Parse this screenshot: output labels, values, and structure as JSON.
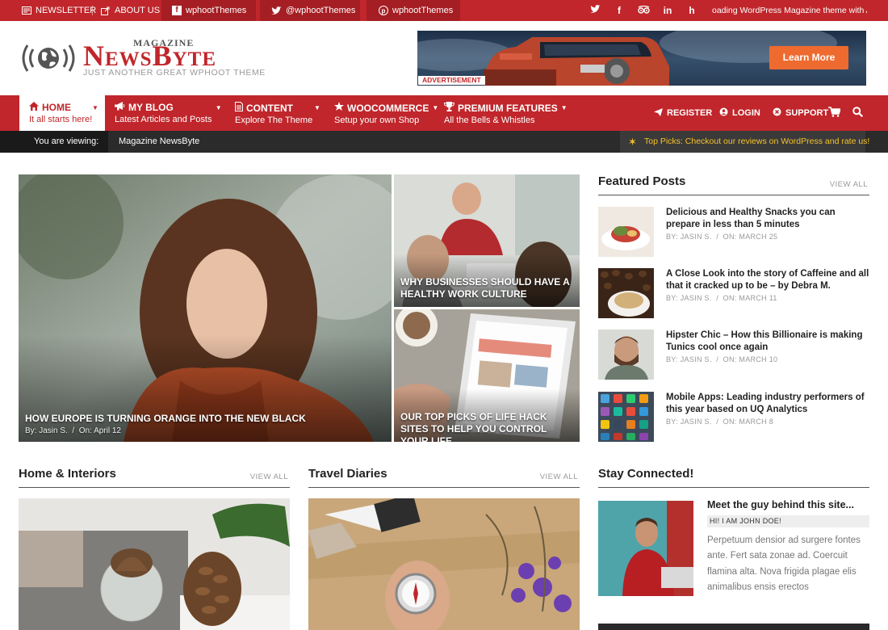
{
  "colors": {
    "brand": "#c0262b",
    "dark": "#2b2b2b",
    "highlight": "#f6c22a"
  },
  "topbar": {
    "newsletter": "NEWSLETTER",
    "about": "ABOUT US",
    "facebook": "wphootThemes",
    "twitter": "@wphootThemes",
    "pinterest": "wphootThemes",
    "social_icons": [
      "twitter-icon",
      "facebook-icon",
      "tripadvisor-icon",
      "linkedin-icon",
      "houzz-icon"
    ],
    "ticker": "oading WordPress Magazine theme with A+"
  },
  "header": {
    "logo_small": "MAGAZINE",
    "logo_main": "NewsByte",
    "tagline": "JUST ANOTHER GREAT WPHOOT THEME",
    "ad_button": "Learn More",
    "ad_label": "ADVERTISEMENT"
  },
  "nav": {
    "items": [
      {
        "title": "HOME",
        "sub": "It all starts here!",
        "icon": "home-icon"
      },
      {
        "title": "MY BLOG",
        "sub": "Latest Articles and Posts",
        "icon": "megaphone-icon"
      },
      {
        "title": "CONTENT",
        "sub": "Explore The Theme",
        "icon": "document-icon"
      },
      {
        "title": "WOOCOMMERCE",
        "sub": "Setup your own Shop",
        "icon": "woocommerce-icon"
      },
      {
        "title": "PREMIUM FEATURES",
        "sub": "All the Bells & Whistles",
        "icon": "trophy-icon"
      }
    ],
    "register": "REGISTER",
    "login": "LOGIN",
    "support": "SUPPORT"
  },
  "viewbar": {
    "label": "You are viewing:",
    "value": "Magazine NewsByte",
    "pick": "Top Picks: Checkout our reviews on WordPress and rate us!"
  },
  "hero": {
    "main": {
      "title": "HOW EUROPE IS TURNING ORANGE INTO THE NEW BLACK",
      "by_label": "By:",
      "author": "Jasin S.",
      "on_label": "On:",
      "date": "April 12"
    },
    "top_right": {
      "title": "WHY BUSINESSES SHOULD HAVE A HEALTHY WORK CULTURE"
    },
    "bottom_right": {
      "title": "OUR TOP PICKS OF LIFE HACK SITES TO HELP YOU CONTROL YOUR LIFE."
    }
  },
  "featured": {
    "heading": "Featured Posts",
    "view_all": "VIEW ALL",
    "by_label": "BY:",
    "on_label": "ON:",
    "posts": [
      {
        "title": "Delicious and Healthy Snacks you can prepare in less than 5 minutes",
        "author": "JASIN S.",
        "date": "MARCH 25"
      },
      {
        "title": "A Close Look into the story of Caffeine and all that it cracked up to be – by Debra M.",
        "author": "JASIN S.",
        "date": "MARCH 11"
      },
      {
        "title": "Hipster Chic – How this Billionaire is making Tunics cool once again",
        "author": "JASIN S.",
        "date": "MARCH 10"
      },
      {
        "title": "Mobile Apps: Leading industry performers of this year based on UQ Analytics",
        "author": "JASIN S.",
        "date": "MARCH 8"
      }
    ]
  },
  "sections": {
    "home": {
      "heading": "Home & Interiors",
      "view_all": "VIEW ALL"
    },
    "travel": {
      "heading": "Travel Diaries",
      "view_all": "VIEW ALL"
    },
    "stay": {
      "heading": "Stay Connected!"
    }
  },
  "about": {
    "title": "Meet the guy behind this site...",
    "hi": "HI! I AM JOHN DOE!",
    "text": "Perpetuum densior ad surgere fontes ante. Fert sata zonae ad. Coercuit flamina alta. Nova frigida plagae elis animalibus ensis erectos"
  }
}
